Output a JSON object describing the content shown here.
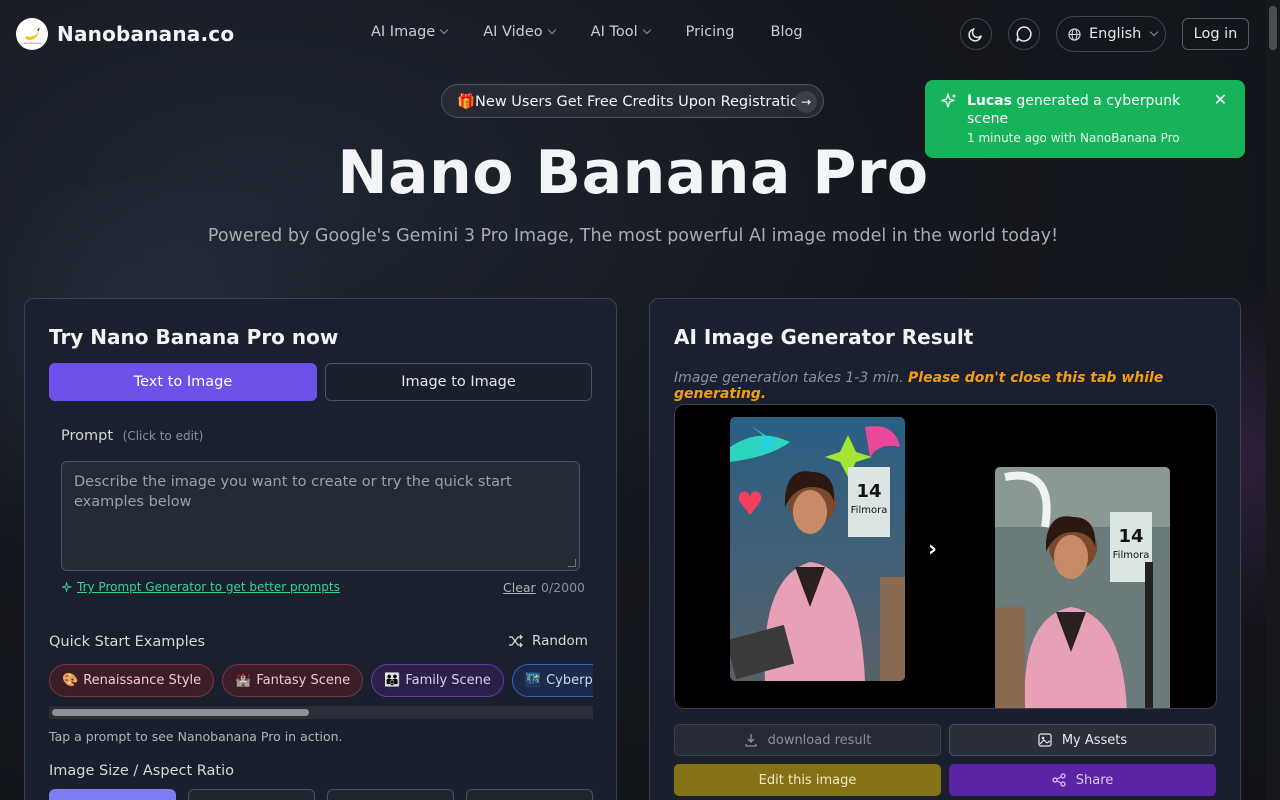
{
  "brand": {
    "name": "Nanobanana.co"
  },
  "nav": {
    "items": [
      {
        "label": "AI Image",
        "has_menu": true
      },
      {
        "label": "AI Video",
        "has_menu": true
      },
      {
        "label": "AI Tool",
        "has_menu": true
      },
      {
        "label": "Pricing",
        "has_menu": false
      },
      {
        "label": "Blog",
        "has_menu": false
      }
    ],
    "language": "English",
    "login_label": "Log in"
  },
  "promo": {
    "text": "🎁New Users Get Free Credits Upon Registration"
  },
  "hero": {
    "title": "Nano Banana Pro",
    "subtitle": "Powered by Google's Gemini 3 Pro Image, The most powerful AI image model in the world today!"
  },
  "toast": {
    "user": "Lucas",
    "action": "generated a cyberpunk scene",
    "time": "1 minute ago with NanoBanana Pro",
    "accent": "#16b35a"
  },
  "left_panel": {
    "title": "Try Nano Banana Pro now",
    "tabs": [
      {
        "label": "Text to Image",
        "active": true
      },
      {
        "label": "Image to Image",
        "active": false
      }
    ],
    "prompt": {
      "label": "Prompt",
      "hint": "(Click to edit)",
      "placeholder": "Describe the image you want to create or try the quick start examples below",
      "value": "",
      "generator_link": "Try Prompt Generator to get better prompts",
      "clear_label": "Clear",
      "counter": "0/2000"
    },
    "quick_start": {
      "label": "Quick Start Examples",
      "random_label": "Random",
      "chips": [
        {
          "emoji": "🎨",
          "label": "Renaissance Style"
        },
        {
          "emoji": "🏰",
          "label": "Fantasy Scene"
        },
        {
          "emoji": "👪",
          "label": "Family Scene"
        },
        {
          "emoji": "🌃",
          "label": "Cyberpunk City"
        }
      ],
      "tap_text": "Tap a prompt to see Nanobanana Pro in action."
    },
    "size_label": "Image Size / Aspect Ratio"
  },
  "right_panel": {
    "title": "AI Image Generator Result",
    "note": "Image generation takes 1-3 min.",
    "note_warning": "Please don't close this tab while generating.",
    "buttons": {
      "download": "download result",
      "assets": "My Assets",
      "edit": "Edit this image",
      "share": "Share"
    }
  },
  "colors": {
    "primary": "#6d51e8",
    "warning": "#f59e0b",
    "success": "#34d399",
    "edit": "#857216",
    "share": "#5b23a6"
  }
}
